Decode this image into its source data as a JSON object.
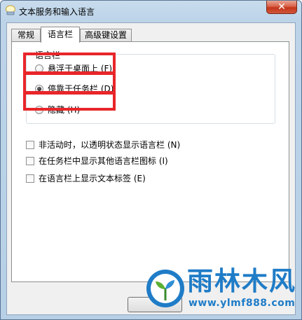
{
  "window": {
    "title": "文本服务和输入语言",
    "close_label": "✕"
  },
  "tabs": [
    {
      "label": "常规",
      "active": false
    },
    {
      "label": "语言栏",
      "active": true
    },
    {
      "label": "高级键设置",
      "active": false
    }
  ],
  "language_bar": {
    "group_label": "语言栏",
    "radios": [
      {
        "label": "悬浮于桌面上 (F)",
        "selected": false
      },
      {
        "label": "停靠于任务栏 (D)",
        "selected": true
      },
      {
        "label": "隐藏 (H)",
        "selected": false
      }
    ],
    "checkboxes": [
      {
        "label": "非活动时，以透明状态显示语言栏 (N)",
        "checked": false
      },
      {
        "label": "在任务栏中显示其他语言栏图标 (I)",
        "checked": false
      },
      {
        "label": "在语言栏上显示文本标签 (E)",
        "checked": false
      }
    ]
  },
  "watermark": {
    "title": "雨林木风",
    "url": "www.ylmf888.com"
  },
  "colors": {
    "highlight": "#e8262a",
    "watermark": "#1f7cc7"
  }
}
